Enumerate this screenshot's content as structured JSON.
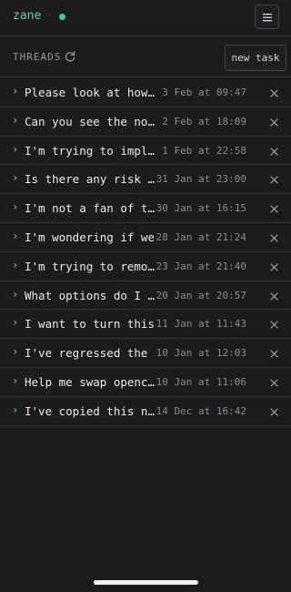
{
  "header": {
    "brand": "zane",
    "separator": "·",
    "status_color": "#3fd17e",
    "menu_icon": "hamburger-icon"
  },
  "threads": {
    "label": "THREADS",
    "refresh_icon": "refresh-icon",
    "new_task_label": "new task",
    "items": [
      {
        "title": "Please look at how the",
        "time": "3 Feb at 09:47"
      },
      {
        "title": "Can you see the notes in",
        "time": "2 Feb at 18:09"
      },
      {
        "title": "I'm trying to implement",
        "time": "1 Feb at 22:58"
      },
      {
        "title": "Is there any risk in",
        "time": "31 Jan at 23:00"
      },
      {
        "title": "I'm not a fan of the",
        "time": "30 Jan at 16:15"
      },
      {
        "title": "I'm wondering if we",
        "time": "28 Jan at 21:24"
      },
      {
        "title": "I'm trying to remove",
        "time": "23 Jan at 21:40"
      },
      {
        "title": "What options do I have",
        "time": "20 Jan at 20:57"
      },
      {
        "title": "I want to turn this",
        "time": "11 Jan at 11:43"
      },
      {
        "title": "I've regressed the",
        "time": "10 Jan at 12:03"
      },
      {
        "title": "Help me swap opencode",
        "time": "10 Jan at 11:06"
      },
      {
        "title": "I've copied this new",
        "time": "14 Dec at 16:42"
      }
    ]
  },
  "colors": {
    "accent": "#5ed39a",
    "background": "#1e1b1d",
    "divider": "#34303a"
  }
}
